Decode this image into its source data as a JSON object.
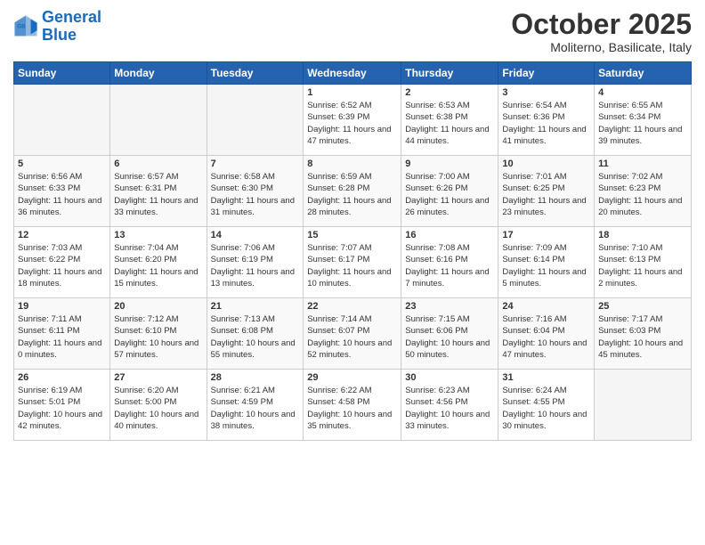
{
  "header": {
    "logo_line1": "General",
    "logo_line2": "Blue",
    "month": "October 2025",
    "location": "Moliterno, Basilicate, Italy"
  },
  "weekdays": [
    "Sunday",
    "Monday",
    "Tuesday",
    "Wednesday",
    "Thursday",
    "Friday",
    "Saturday"
  ],
  "weeks": [
    [
      {
        "day": "",
        "info": ""
      },
      {
        "day": "",
        "info": ""
      },
      {
        "day": "",
        "info": ""
      },
      {
        "day": "1",
        "info": "Sunrise: 6:52 AM\nSunset: 6:39 PM\nDaylight: 11 hours and 47 minutes."
      },
      {
        "day": "2",
        "info": "Sunrise: 6:53 AM\nSunset: 6:38 PM\nDaylight: 11 hours and 44 minutes."
      },
      {
        "day": "3",
        "info": "Sunrise: 6:54 AM\nSunset: 6:36 PM\nDaylight: 11 hours and 41 minutes."
      },
      {
        "day": "4",
        "info": "Sunrise: 6:55 AM\nSunset: 6:34 PM\nDaylight: 11 hours and 39 minutes."
      }
    ],
    [
      {
        "day": "5",
        "info": "Sunrise: 6:56 AM\nSunset: 6:33 PM\nDaylight: 11 hours and 36 minutes."
      },
      {
        "day": "6",
        "info": "Sunrise: 6:57 AM\nSunset: 6:31 PM\nDaylight: 11 hours and 33 minutes."
      },
      {
        "day": "7",
        "info": "Sunrise: 6:58 AM\nSunset: 6:30 PM\nDaylight: 11 hours and 31 minutes."
      },
      {
        "day": "8",
        "info": "Sunrise: 6:59 AM\nSunset: 6:28 PM\nDaylight: 11 hours and 28 minutes."
      },
      {
        "day": "9",
        "info": "Sunrise: 7:00 AM\nSunset: 6:26 PM\nDaylight: 11 hours and 26 minutes."
      },
      {
        "day": "10",
        "info": "Sunrise: 7:01 AM\nSunset: 6:25 PM\nDaylight: 11 hours and 23 minutes."
      },
      {
        "day": "11",
        "info": "Sunrise: 7:02 AM\nSunset: 6:23 PM\nDaylight: 11 hours and 20 minutes."
      }
    ],
    [
      {
        "day": "12",
        "info": "Sunrise: 7:03 AM\nSunset: 6:22 PM\nDaylight: 11 hours and 18 minutes."
      },
      {
        "day": "13",
        "info": "Sunrise: 7:04 AM\nSunset: 6:20 PM\nDaylight: 11 hours and 15 minutes."
      },
      {
        "day": "14",
        "info": "Sunrise: 7:06 AM\nSunset: 6:19 PM\nDaylight: 11 hours and 13 minutes."
      },
      {
        "day": "15",
        "info": "Sunrise: 7:07 AM\nSunset: 6:17 PM\nDaylight: 11 hours and 10 minutes."
      },
      {
        "day": "16",
        "info": "Sunrise: 7:08 AM\nSunset: 6:16 PM\nDaylight: 11 hours and 7 minutes."
      },
      {
        "day": "17",
        "info": "Sunrise: 7:09 AM\nSunset: 6:14 PM\nDaylight: 11 hours and 5 minutes."
      },
      {
        "day": "18",
        "info": "Sunrise: 7:10 AM\nSunset: 6:13 PM\nDaylight: 11 hours and 2 minutes."
      }
    ],
    [
      {
        "day": "19",
        "info": "Sunrise: 7:11 AM\nSunset: 6:11 PM\nDaylight: 11 hours and 0 minutes."
      },
      {
        "day": "20",
        "info": "Sunrise: 7:12 AM\nSunset: 6:10 PM\nDaylight: 10 hours and 57 minutes."
      },
      {
        "day": "21",
        "info": "Sunrise: 7:13 AM\nSunset: 6:08 PM\nDaylight: 10 hours and 55 minutes."
      },
      {
        "day": "22",
        "info": "Sunrise: 7:14 AM\nSunset: 6:07 PM\nDaylight: 10 hours and 52 minutes."
      },
      {
        "day": "23",
        "info": "Sunrise: 7:15 AM\nSunset: 6:06 PM\nDaylight: 10 hours and 50 minutes."
      },
      {
        "day": "24",
        "info": "Sunrise: 7:16 AM\nSunset: 6:04 PM\nDaylight: 10 hours and 47 minutes."
      },
      {
        "day": "25",
        "info": "Sunrise: 7:17 AM\nSunset: 6:03 PM\nDaylight: 10 hours and 45 minutes."
      }
    ],
    [
      {
        "day": "26",
        "info": "Sunrise: 6:19 AM\nSunset: 5:01 PM\nDaylight: 10 hours and 42 minutes."
      },
      {
        "day": "27",
        "info": "Sunrise: 6:20 AM\nSunset: 5:00 PM\nDaylight: 10 hours and 40 minutes."
      },
      {
        "day": "28",
        "info": "Sunrise: 6:21 AM\nSunset: 4:59 PM\nDaylight: 10 hours and 38 minutes."
      },
      {
        "day": "29",
        "info": "Sunrise: 6:22 AM\nSunset: 4:58 PM\nDaylight: 10 hours and 35 minutes."
      },
      {
        "day": "30",
        "info": "Sunrise: 6:23 AM\nSunset: 4:56 PM\nDaylight: 10 hours and 33 minutes."
      },
      {
        "day": "31",
        "info": "Sunrise: 6:24 AM\nSunset: 4:55 PM\nDaylight: 10 hours and 30 minutes."
      },
      {
        "day": "",
        "info": ""
      }
    ]
  ]
}
